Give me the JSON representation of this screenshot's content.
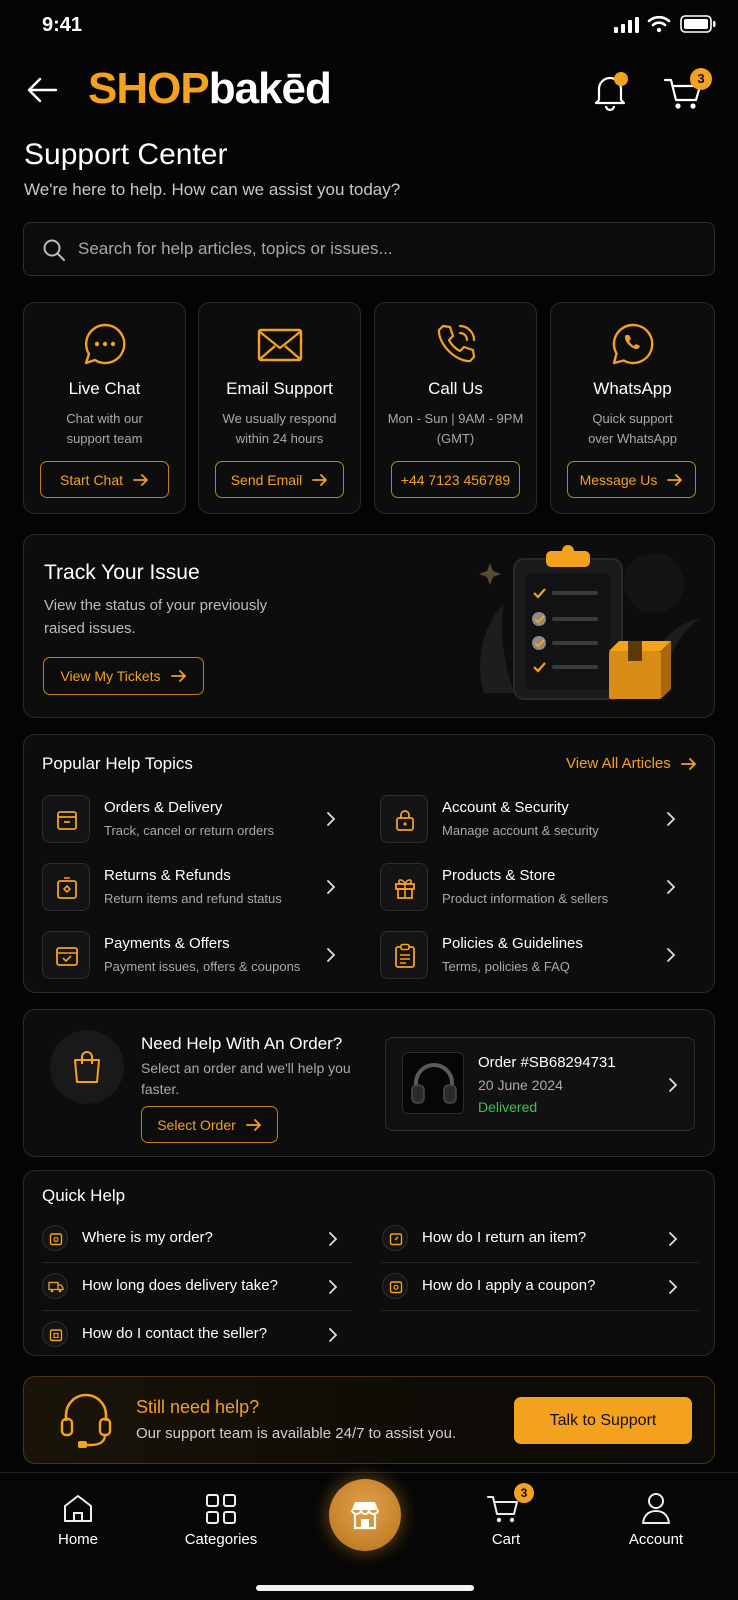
{
  "status_bar": {
    "time": "9:41"
  },
  "header": {
    "logo_shop": "SHOP",
    "logo_baked": "bakēd",
    "cart_badge": "3"
  },
  "page": {
    "title": "Support Center",
    "subtitle": "We're here to help. How can we assist you today?"
  },
  "search": {
    "placeholder": "Search for help articles, topics or issues..."
  },
  "contact_cards": [
    {
      "title": "Live Chat",
      "desc1": "Chat with our",
      "desc2": "support team",
      "button": "Start Chat"
    },
    {
      "title": "Email Support",
      "desc1": "We usually respond",
      "desc2": "within 24 hours",
      "button": "Send Email"
    },
    {
      "title": "Call Us",
      "desc1": "Mon - Sun | 9AM - 9PM",
      "desc2": "(GMT)",
      "button": "+44 7123 456789"
    },
    {
      "title": "WhatsApp",
      "desc1": "Quick support",
      "desc2": "over WhatsApp",
      "button": "Message Us"
    }
  ],
  "track": {
    "title": "Track Your Issue",
    "desc1": "View the status of your previously",
    "desc2": "raised issues.",
    "button": "View My Tickets"
  },
  "topics": {
    "title": "Popular Help Topics",
    "view_all": "View All Articles",
    "items": [
      {
        "title": "Orders & Delivery",
        "desc": "Track, cancel or return orders"
      },
      {
        "title": "Account & Security",
        "desc": "Manage account & security"
      },
      {
        "title": "Returns & Refunds",
        "desc": "Return items and refund status"
      },
      {
        "title": "Products & Store",
        "desc": "Product information & sellers"
      },
      {
        "title": "Payments & Offers",
        "desc": "Payment issues, offers & coupons"
      },
      {
        "title": "Policies & Guidelines",
        "desc": "Terms, policies & FAQ"
      }
    ]
  },
  "order_help": {
    "title": "Need Help With An Order?",
    "desc1": "Select an order and we'll help you",
    "desc2": "faster.",
    "button": "Select Order",
    "order_number": "Order #SB68294731",
    "order_date": "20 June 2024",
    "order_status": "Delivered"
  },
  "quick_help": {
    "title": "Quick Help",
    "items": [
      "Where is my order?",
      "How do I return an item?",
      "How long does delivery take?",
      "How do I apply a coupon?",
      "How do I contact the seller?"
    ]
  },
  "still_help": {
    "title": "Still need help?",
    "desc": "Our support team is available 24/7 to assist you.",
    "button": "Talk to Support"
  },
  "bottom_nav": {
    "home": "Home",
    "categories": "Categories",
    "cart": "Cart",
    "cart_badge": "3",
    "account": "Account"
  },
  "colors": {
    "accent": "#f4a11e",
    "delivered": "#3ec24a",
    "background": "#050505"
  }
}
